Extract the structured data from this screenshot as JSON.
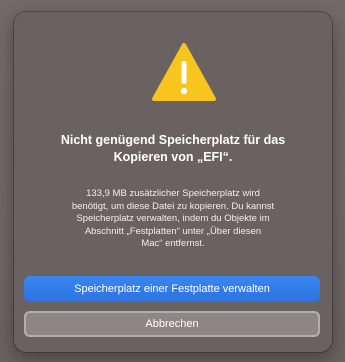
{
  "dialog": {
    "title_line1": "Nicht genügend Speicherplatz für das",
    "title_line2": "Kopieren von „EFI“.",
    "message_lines": [
      "133,9 MB zusätzlicher Speicherplatz wird",
      "benötigt, um diese Datei zu kopieren. Du kannst",
      "Speicherplatz verwalten, indem du Objekte im",
      "Abschnitt „Festplatten“ unter „Über diesen",
      "Mac“ entfernst."
    ],
    "primary_button_label": "Speicherplatz einer Festplatte verwalten",
    "cancel_button_label": "Abbrechen",
    "icon": "warning-triangle-icon"
  },
  "colors": {
    "accent": "#2f78e6",
    "warning": "#f7c51e",
    "dialog_background": "#696261"
  }
}
